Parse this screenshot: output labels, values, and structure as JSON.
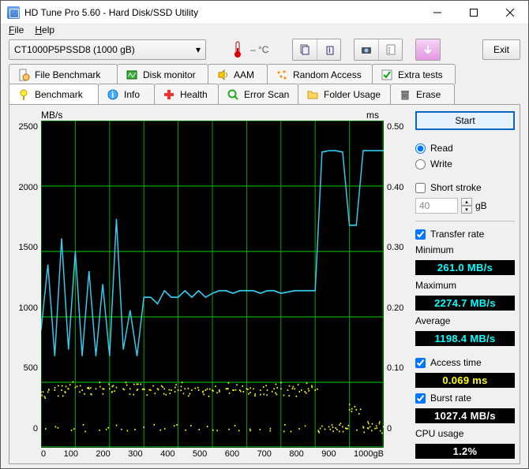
{
  "window": {
    "title": "HD Tune Pro 5.60 - Hard Disk/SSD Utility"
  },
  "menu": {
    "file": "File",
    "help": "Help"
  },
  "toolbar": {
    "device": "CT1000P5PSSD8 (1000 gB)",
    "temp": "– °C",
    "exit": "Exit"
  },
  "tabs_row1": [
    {
      "label": "File Benchmark"
    },
    {
      "label": "Disk monitor"
    },
    {
      "label": "AAM"
    },
    {
      "label": "Random Access"
    },
    {
      "label": "Extra tests"
    }
  ],
  "tabs_row2": [
    {
      "label": "Benchmark"
    },
    {
      "label": "Info"
    },
    {
      "label": "Health"
    },
    {
      "label": "Error Scan"
    },
    {
      "label": "Folder Usage"
    },
    {
      "label": "Erase"
    }
  ],
  "chart": {
    "y_label": "MB/s",
    "y2_label": "ms",
    "y_ticks": [
      "2500",
      "2000",
      "1500",
      "1000",
      "500",
      "0"
    ],
    "y2_ticks": [
      "0.50",
      "0.40",
      "0.30",
      "0.20",
      "0.10",
      "0"
    ],
    "x_ticks": [
      "0",
      "100",
      "200",
      "300",
      "400",
      "500",
      "600",
      "700",
      "800",
      "900",
      "1000gB"
    ]
  },
  "chart_data": {
    "type": "line",
    "title": "",
    "xlabel": "gB",
    "ylabel": "MB/s",
    "ylim": [
      0,
      2500
    ],
    "y2label": "ms",
    "y2lim": [
      0,
      0.5
    ],
    "x": [
      0,
      20,
      40,
      60,
      80,
      100,
      120,
      140,
      160,
      180,
      200,
      220,
      240,
      260,
      280,
      300,
      320,
      340,
      360,
      380,
      400,
      420,
      440,
      460,
      480,
      500,
      520,
      540,
      560,
      580,
      600,
      620,
      640,
      660,
      680,
      700,
      720,
      740,
      760,
      780,
      800,
      820,
      840,
      860,
      880,
      900,
      920,
      940,
      960,
      980,
      1000
    ],
    "series": [
      {
        "name": "Transfer rate (MB/s)",
        "axis": "y",
        "values": [
          900,
          1400,
          700,
          1600,
          750,
          1500,
          700,
          1350,
          700,
          1250,
          700,
          1750,
          750,
          1050,
          700,
          1150,
          1150,
          1100,
          1200,
          1150,
          1150,
          1200,
          1150,
          1200,
          1150,
          1180,
          1200,
          1200,
          1180,
          1200,
          1200,
          1200,
          1180,
          1200,
          1200,
          1180,
          1190,
          1200,
          1200,
          1200,
          1200,
          2260,
          2270,
          2270,
          2260,
          1700,
          1700,
          2270,
          2270,
          2270,
          2270
        ]
      },
      {
        "name": "Access time (ms)",
        "axis": "y2",
        "style": "scatter",
        "values": [
          0.085,
          0.085,
          0.088,
          0.088,
          0.09,
          0.092,
          0.088,
          0.09,
          0.09,
          0.09,
          0.09,
          0.092,
          0.09,
          0.09,
          0.088,
          0.09,
          0.088,
          0.09,
          0.09,
          0.088,
          0.088,
          0.09,
          0.088,
          0.088,
          0.088,
          0.088,
          0.088,
          0.09,
          0.088,
          0.088,
          0.09,
          0.09,
          0.088,
          0.088,
          0.09,
          0.09,
          0.088,
          0.09,
          0.088,
          0.09,
          0.088,
          0.033,
          0.032,
          0.03,
          0.032,
          0.058,
          0.058,
          0.032,
          0.032,
          0.03,
          0.032
        ]
      }
    ]
  },
  "side": {
    "start": "Start",
    "read": "Read",
    "write": "Write",
    "short_stroke": "Short stroke",
    "stroke_val": "40",
    "stroke_unit": "gB",
    "transfer_rate": "Transfer rate",
    "min_label": "Minimum",
    "min_val": "261.0 MB/s",
    "max_label": "Maximum",
    "max_val": "2274.7 MB/s",
    "avg_label": "Average",
    "avg_val": "1198.4 MB/s",
    "access_label": "Access time",
    "access_val": "0.069 ms",
    "burst_label": "Burst rate",
    "burst_val": "1027.4 MB/s",
    "cpu_label": "CPU usage",
    "cpu_val": "1.2%"
  }
}
